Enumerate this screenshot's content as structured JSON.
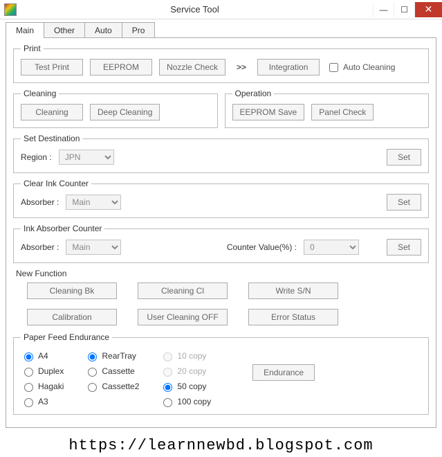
{
  "window": {
    "title": "Service Tool"
  },
  "tabs": [
    "Main",
    "Other",
    "Auto",
    "Pro"
  ],
  "print": {
    "legend": "Print",
    "test_print": "Test Print",
    "eeprom": "EEPROM",
    "nozzle_check": "Nozzle Check",
    "integration": "Integration",
    "auto_cleaning": "Auto Cleaning"
  },
  "cleaning": {
    "legend": "Cleaning",
    "cleaning": "Cleaning",
    "deep_cleaning": "Deep Cleaning"
  },
  "operation": {
    "legend": "Operation",
    "eeprom_save": "EEPROM Save",
    "panel_check": "Panel Check"
  },
  "set_destination": {
    "legend": "Set Destination",
    "region_label": "Region :",
    "region_value": "JPN",
    "set": "Set"
  },
  "clear_ink": {
    "legend": "Clear Ink Counter",
    "absorber_label": "Absorber :",
    "absorber_value": "Main",
    "set": "Set"
  },
  "ink_absorber": {
    "legend": "Ink Absorber Counter",
    "absorber_label": "Absorber :",
    "absorber_value": "Main",
    "counter_label": "Counter Value(%) :",
    "counter_value": "0",
    "set": "Set"
  },
  "new_function": {
    "label": "New Function",
    "cleaning_bk": "Cleaning Bk",
    "cleaning_cl": "Cleaning Cl",
    "write_sn": "Write S/N",
    "calibration": "Calibration",
    "user_cleaning_off": "User Cleaning OFF",
    "error_status": "Error Status"
  },
  "paper_feed": {
    "legend": "Paper Feed Endurance",
    "size": {
      "a4": "A4",
      "duplex": "Duplex",
      "hagaki": "Hagaki",
      "a3": "A3",
      "selected": "a4"
    },
    "tray": {
      "rear": "RearTray",
      "cassette": "Cassette",
      "cassette2": "Cassette2",
      "selected": "rear"
    },
    "copy": {
      "c10": "10 copy",
      "c20": "20 copy",
      "c50": "50 copy",
      "c100": "100 copy",
      "selected": "c50"
    },
    "endurance": "Endurance"
  },
  "footer_url": "https://learnnewbd.blogspot.com"
}
